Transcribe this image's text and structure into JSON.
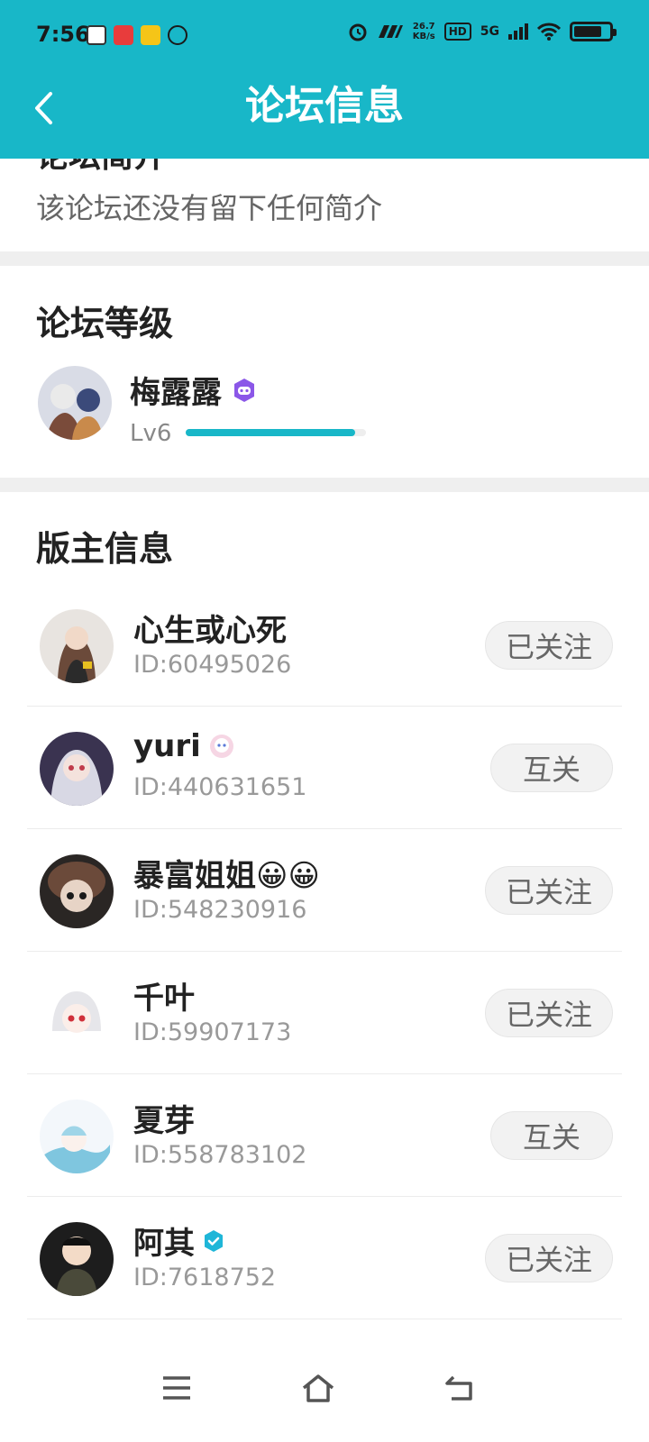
{
  "status_bar": {
    "time": "7:56",
    "speed_value": "26.7",
    "speed_unit": "KB/s",
    "hd": "HD",
    "network": "5G"
  },
  "header": {
    "title": "论坛信息"
  },
  "intro": {
    "heading": "论坛简介",
    "text": "该论坛还没有留下任何简介"
  },
  "level_section": {
    "title": "论坛等级",
    "owner_name": "梅露露",
    "level_label": "Lv6",
    "level_progress": 0.94
  },
  "moderators": {
    "title": "版主信息",
    "items": [
      {
        "name": "心生或心死",
        "badge": "",
        "id": "ID:60495026",
        "follow_label": "已关注"
      },
      {
        "name": "yuri",
        "badge": "avatar-badge-icon",
        "id": "ID:440631651",
        "follow_label": "互关"
      },
      {
        "name": "暴富姐姐😀😀",
        "badge": "",
        "id": "ID:548230916",
        "follow_label": "已关注"
      },
      {
        "name": "千叶",
        "badge": "",
        "id": "ID:59907173",
        "follow_label": "已关注"
      },
      {
        "name": "夏芽",
        "badge": "",
        "id": "ID:558783102",
        "follow_label": "互关"
      },
      {
        "name": "阿其",
        "badge": "verified-icon",
        "id": "ID:7618752",
        "follow_label": "已关注"
      }
    ]
  },
  "colors": {
    "accent": "#18b7c8",
    "badge_purple": "#8b57e8"
  }
}
